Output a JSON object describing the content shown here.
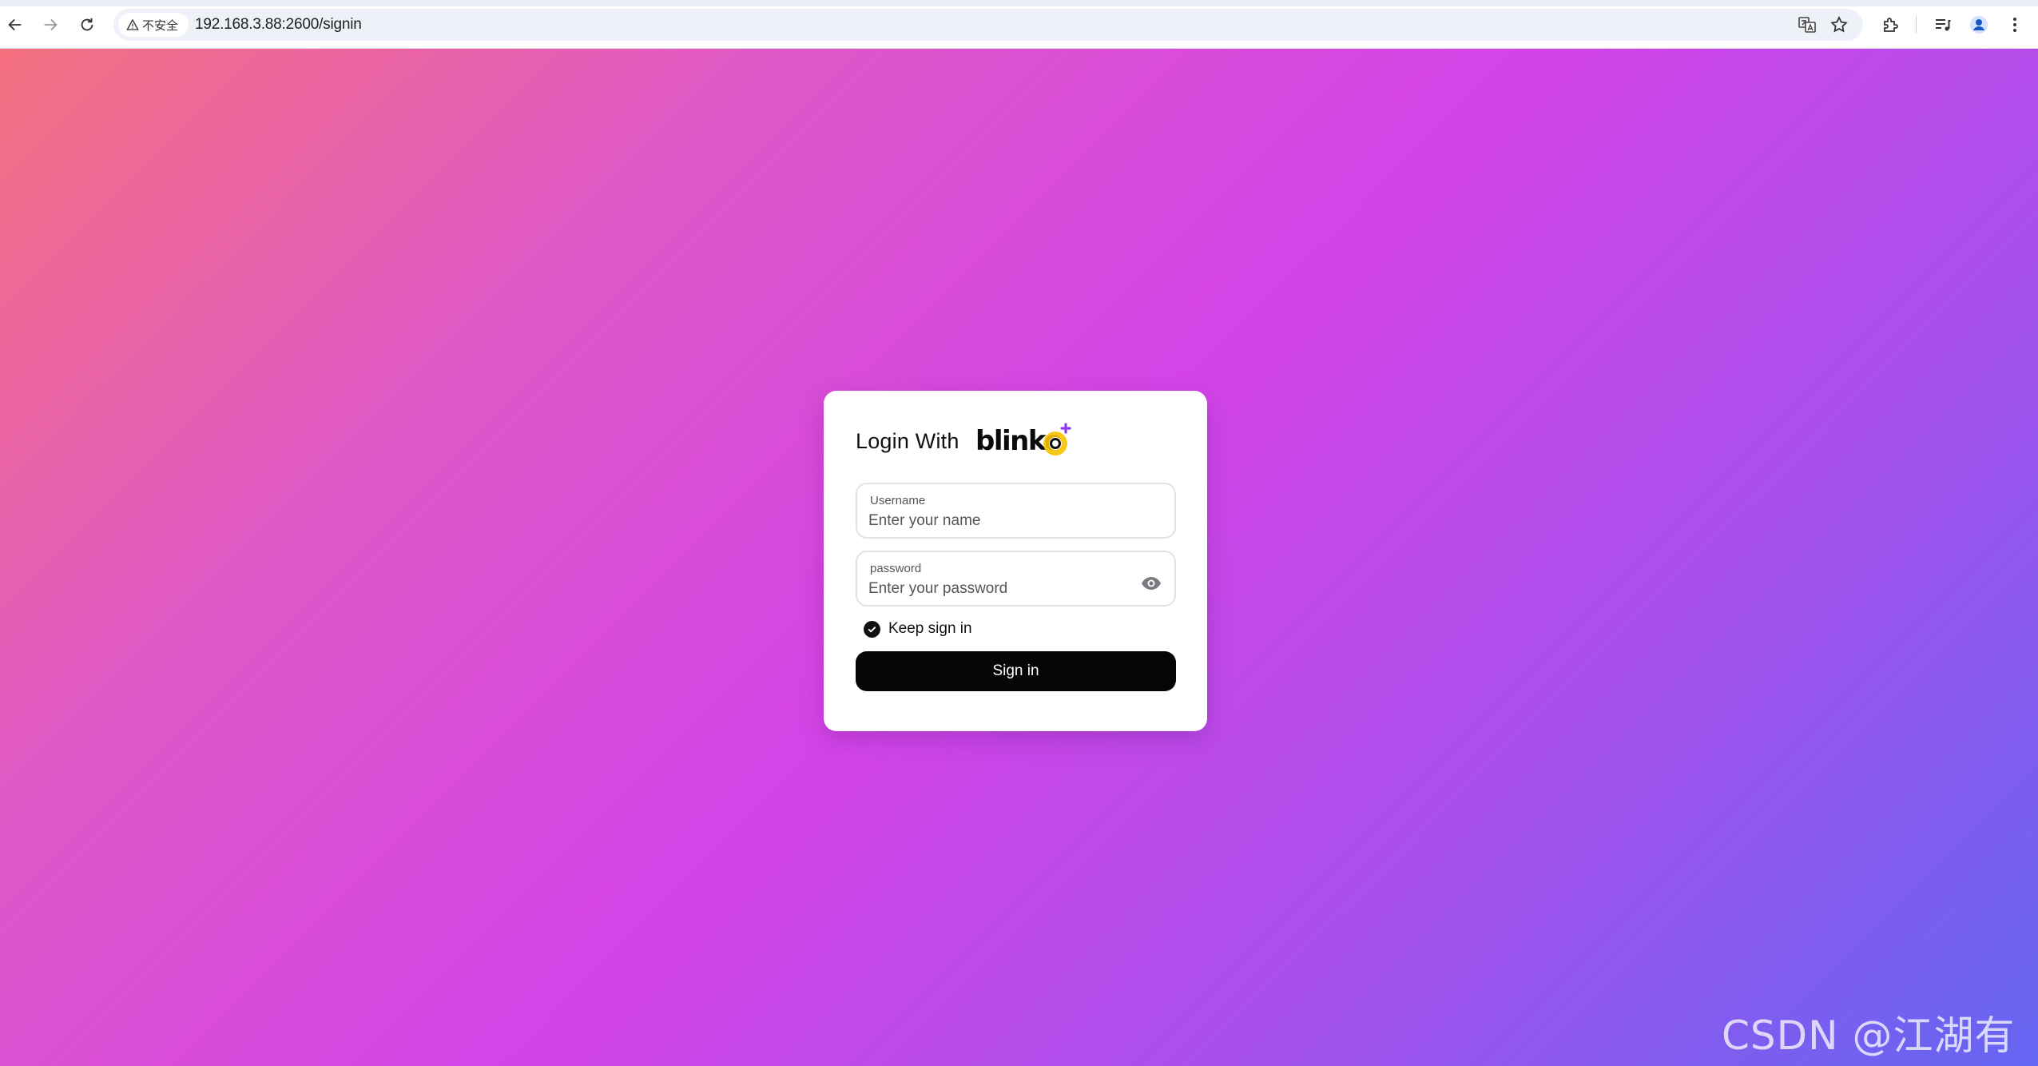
{
  "browser": {
    "security_label": "不安全",
    "url": "192.168.3.88:2600/signin"
  },
  "login": {
    "title": "Login With",
    "logo_text": "blinko",
    "username": {
      "label": "Username",
      "placeholder": "Enter your name"
    },
    "password": {
      "label": "password",
      "placeholder": "Enter your password"
    },
    "keep_signed_in": "Keep sign in",
    "submit_label": "Sign in"
  },
  "watermark": "CSDN @江湖有缘",
  "colors": {
    "gradient_start": "#f4717f",
    "gradient_mid": "#d443e8",
    "gradient_end": "#6366f1",
    "button": "#050505",
    "logo_accent": "#f7c200",
    "logo_star": "#8b3cf0"
  }
}
